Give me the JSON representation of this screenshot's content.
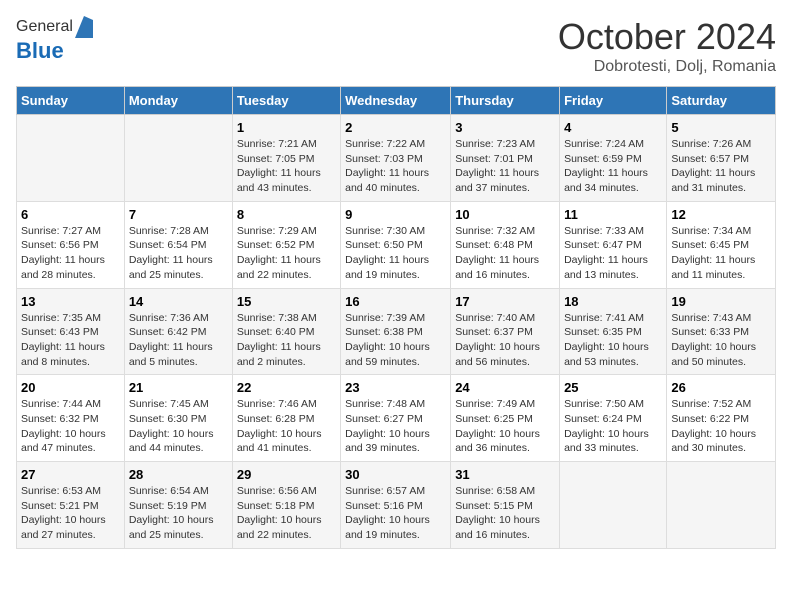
{
  "header": {
    "logo_general": "General",
    "logo_blue": "Blue",
    "month_title": "October 2024",
    "location": "Dobrotesti, Dolj, Romania"
  },
  "days_of_week": [
    "Sunday",
    "Monday",
    "Tuesday",
    "Wednesday",
    "Thursday",
    "Friday",
    "Saturday"
  ],
  "weeks": [
    [
      {
        "day": "",
        "sunrise": "",
        "sunset": "",
        "daylight": ""
      },
      {
        "day": "",
        "sunrise": "",
        "sunset": "",
        "daylight": ""
      },
      {
        "day": "1",
        "sunrise": "Sunrise: 7:21 AM",
        "sunset": "Sunset: 7:05 PM",
        "daylight": "Daylight: 11 hours and 43 minutes."
      },
      {
        "day": "2",
        "sunrise": "Sunrise: 7:22 AM",
        "sunset": "Sunset: 7:03 PM",
        "daylight": "Daylight: 11 hours and 40 minutes."
      },
      {
        "day": "3",
        "sunrise": "Sunrise: 7:23 AM",
        "sunset": "Sunset: 7:01 PM",
        "daylight": "Daylight: 11 hours and 37 minutes."
      },
      {
        "day": "4",
        "sunrise": "Sunrise: 7:24 AM",
        "sunset": "Sunset: 6:59 PM",
        "daylight": "Daylight: 11 hours and 34 minutes."
      },
      {
        "day": "5",
        "sunrise": "Sunrise: 7:26 AM",
        "sunset": "Sunset: 6:57 PM",
        "daylight": "Daylight: 11 hours and 31 minutes."
      }
    ],
    [
      {
        "day": "6",
        "sunrise": "Sunrise: 7:27 AM",
        "sunset": "Sunset: 6:56 PM",
        "daylight": "Daylight: 11 hours and 28 minutes."
      },
      {
        "day": "7",
        "sunrise": "Sunrise: 7:28 AM",
        "sunset": "Sunset: 6:54 PM",
        "daylight": "Daylight: 11 hours and 25 minutes."
      },
      {
        "day": "8",
        "sunrise": "Sunrise: 7:29 AM",
        "sunset": "Sunset: 6:52 PM",
        "daylight": "Daylight: 11 hours and 22 minutes."
      },
      {
        "day": "9",
        "sunrise": "Sunrise: 7:30 AM",
        "sunset": "Sunset: 6:50 PM",
        "daylight": "Daylight: 11 hours and 19 minutes."
      },
      {
        "day": "10",
        "sunrise": "Sunrise: 7:32 AM",
        "sunset": "Sunset: 6:48 PM",
        "daylight": "Daylight: 11 hours and 16 minutes."
      },
      {
        "day": "11",
        "sunrise": "Sunrise: 7:33 AM",
        "sunset": "Sunset: 6:47 PM",
        "daylight": "Daylight: 11 hours and 13 minutes."
      },
      {
        "day": "12",
        "sunrise": "Sunrise: 7:34 AM",
        "sunset": "Sunset: 6:45 PM",
        "daylight": "Daylight: 11 hours and 11 minutes."
      }
    ],
    [
      {
        "day": "13",
        "sunrise": "Sunrise: 7:35 AM",
        "sunset": "Sunset: 6:43 PM",
        "daylight": "Daylight: 11 hours and 8 minutes."
      },
      {
        "day": "14",
        "sunrise": "Sunrise: 7:36 AM",
        "sunset": "Sunset: 6:42 PM",
        "daylight": "Daylight: 11 hours and 5 minutes."
      },
      {
        "day": "15",
        "sunrise": "Sunrise: 7:38 AM",
        "sunset": "Sunset: 6:40 PM",
        "daylight": "Daylight: 11 hours and 2 minutes."
      },
      {
        "day": "16",
        "sunrise": "Sunrise: 7:39 AM",
        "sunset": "Sunset: 6:38 PM",
        "daylight": "Daylight: 10 hours and 59 minutes."
      },
      {
        "day": "17",
        "sunrise": "Sunrise: 7:40 AM",
        "sunset": "Sunset: 6:37 PM",
        "daylight": "Daylight: 10 hours and 56 minutes."
      },
      {
        "day": "18",
        "sunrise": "Sunrise: 7:41 AM",
        "sunset": "Sunset: 6:35 PM",
        "daylight": "Daylight: 10 hours and 53 minutes."
      },
      {
        "day": "19",
        "sunrise": "Sunrise: 7:43 AM",
        "sunset": "Sunset: 6:33 PM",
        "daylight": "Daylight: 10 hours and 50 minutes."
      }
    ],
    [
      {
        "day": "20",
        "sunrise": "Sunrise: 7:44 AM",
        "sunset": "Sunset: 6:32 PM",
        "daylight": "Daylight: 10 hours and 47 minutes."
      },
      {
        "day": "21",
        "sunrise": "Sunrise: 7:45 AM",
        "sunset": "Sunset: 6:30 PM",
        "daylight": "Daylight: 10 hours and 44 minutes."
      },
      {
        "day": "22",
        "sunrise": "Sunrise: 7:46 AM",
        "sunset": "Sunset: 6:28 PM",
        "daylight": "Daylight: 10 hours and 41 minutes."
      },
      {
        "day": "23",
        "sunrise": "Sunrise: 7:48 AM",
        "sunset": "Sunset: 6:27 PM",
        "daylight": "Daylight: 10 hours and 39 minutes."
      },
      {
        "day": "24",
        "sunrise": "Sunrise: 7:49 AM",
        "sunset": "Sunset: 6:25 PM",
        "daylight": "Daylight: 10 hours and 36 minutes."
      },
      {
        "day": "25",
        "sunrise": "Sunrise: 7:50 AM",
        "sunset": "Sunset: 6:24 PM",
        "daylight": "Daylight: 10 hours and 33 minutes."
      },
      {
        "day": "26",
        "sunrise": "Sunrise: 7:52 AM",
        "sunset": "Sunset: 6:22 PM",
        "daylight": "Daylight: 10 hours and 30 minutes."
      }
    ],
    [
      {
        "day": "27",
        "sunrise": "Sunrise: 6:53 AM",
        "sunset": "Sunset: 5:21 PM",
        "daylight": "Daylight: 10 hours and 27 minutes."
      },
      {
        "day": "28",
        "sunrise": "Sunrise: 6:54 AM",
        "sunset": "Sunset: 5:19 PM",
        "daylight": "Daylight: 10 hours and 25 minutes."
      },
      {
        "day": "29",
        "sunrise": "Sunrise: 6:56 AM",
        "sunset": "Sunset: 5:18 PM",
        "daylight": "Daylight: 10 hours and 22 minutes."
      },
      {
        "day": "30",
        "sunrise": "Sunrise: 6:57 AM",
        "sunset": "Sunset: 5:16 PM",
        "daylight": "Daylight: 10 hours and 19 minutes."
      },
      {
        "day": "31",
        "sunrise": "Sunrise: 6:58 AM",
        "sunset": "Sunset: 5:15 PM",
        "daylight": "Daylight: 10 hours and 16 minutes."
      },
      {
        "day": "",
        "sunrise": "",
        "sunset": "",
        "daylight": ""
      },
      {
        "day": "",
        "sunrise": "",
        "sunset": "",
        "daylight": ""
      }
    ]
  ]
}
